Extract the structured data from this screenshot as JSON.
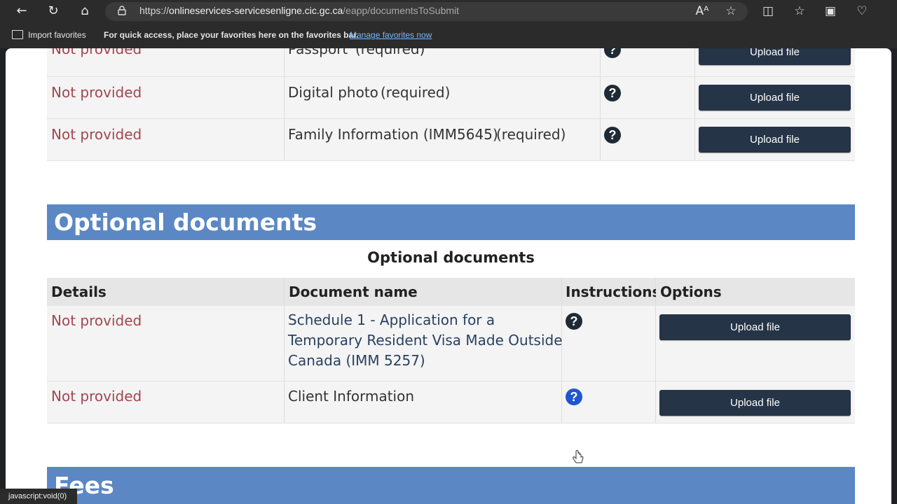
{
  "browser": {
    "url_prefix": "https://",
    "url_host": "onlineservices-servicesenligne.cic.gc.ca",
    "url_path": "/eapp/documentsToSubmit",
    "favorites": {
      "import_label": "Import favorites",
      "quick_access_text": "For quick access, place your favorites here on the favorites bar.",
      "manage_link": "Manage favorites now"
    },
    "status_text": "javascript:void(0)"
  },
  "required_rows": [
    {
      "details": "Not provided",
      "document": "Passport",
      "requirement": "(required)",
      "upload_label": "Upload file"
    },
    {
      "details": "Not provided",
      "document": "Digital photo",
      "requirement": "(required)",
      "upload_label": "Upload file"
    },
    {
      "details": "Not provided",
      "document": "Family Information (IMM5645)",
      "requirement": "(required)",
      "upload_label": "Upload file"
    }
  ],
  "optional_section": {
    "title": "Optional documents",
    "caption": "Optional documents",
    "headers": {
      "details": "Details",
      "document_name": "Document name",
      "instructions": "Instructions",
      "options": "Options"
    },
    "rows": [
      {
        "details": "Not provided",
        "document_name": "Schedule 1 - Application for a Temporary Resident Visa Made Outside Canada (IMM 5257)",
        "upload_label": "Upload file"
      },
      {
        "details": "Not provided",
        "document_name": "Client Information",
        "upload_label": "Upload file"
      }
    ]
  },
  "fees_section": {
    "title": "Fees"
  },
  "icons": {
    "help": "?",
    "back": "←",
    "refresh": "↻",
    "home": "⌂",
    "read_aloud": "Aᴬ",
    "star": "☆",
    "split": "◫",
    "favorites": "☆",
    "collections": "▣",
    "health": "♡"
  },
  "colors": {
    "accent": "#5b88c4",
    "button": "#253446",
    "not_provided": "#a3454d",
    "link": "#284162"
  }
}
